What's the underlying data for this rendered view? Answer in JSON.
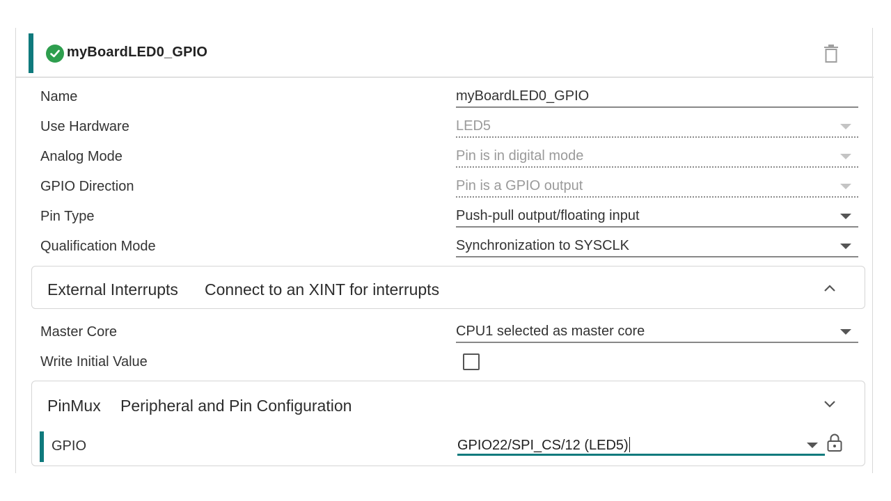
{
  "header": {
    "title": "myBoardLED0_GPIO",
    "status_icon": "check-circle-icon",
    "status_color": "#2e9e4e",
    "accent_color": "#0f7a7d",
    "delete_icon": "trash-icon"
  },
  "fields": [
    {
      "label": "Name",
      "value": "myBoardLED0_GPIO",
      "type": "text",
      "disabled": false
    },
    {
      "label": "Use Hardware",
      "value": "LED5",
      "type": "select",
      "disabled": true
    },
    {
      "label": "Analog Mode",
      "value": "Pin is in digital mode",
      "type": "select",
      "disabled": true
    },
    {
      "label": "GPIO Direction",
      "value": "Pin is a GPIO output",
      "type": "select",
      "disabled": true
    },
    {
      "label": "Pin Type",
      "value": "Push-pull output/floating input",
      "type": "select",
      "disabled": false
    },
    {
      "label": "Qualification Mode",
      "value": "Synchronization to SYSCLK",
      "type": "select",
      "disabled": false
    }
  ],
  "external_interrupts": {
    "title": "External Interrupts",
    "subtitle": "Connect to an XINT for interrupts",
    "expanded": false,
    "chevron_icon": "chevron-up-icon"
  },
  "master_core": {
    "label": "Master Core",
    "value": "CPU1 selected as master core"
  },
  "write_initial_value": {
    "label": "Write Initial Value",
    "checked": false
  },
  "pinmux": {
    "title": "PinMux",
    "subtitle": "Peripheral and Pin Configuration",
    "chevron_icon": "chevron-down-icon",
    "gpio": {
      "label": "GPIO",
      "value": "GPIO22/SPI_CS/12 (LED5)",
      "lock_icon": "lock-icon"
    }
  }
}
